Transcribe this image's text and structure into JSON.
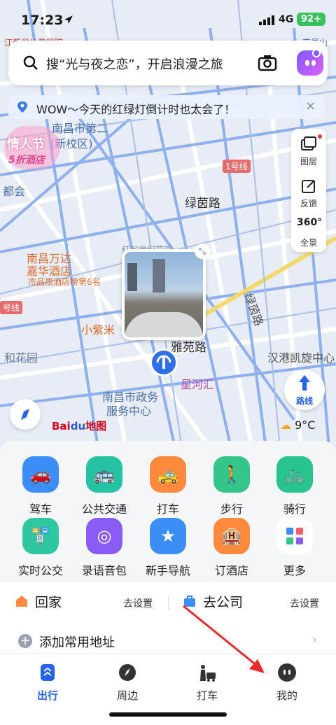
{
  "status": {
    "time": "17:23",
    "network": "4G",
    "battery": "92+"
  },
  "search": {
    "placeholder": "搜“光与夜之恋”，开启浪漫之旅"
  },
  "tip": {
    "text": "WOW～今天的红绿灯倒计时也太会了！",
    "close": "×"
  },
  "side_tools": [
    {
      "label": "图层",
      "icon": "layers-icon"
    },
    {
      "label": "反馈",
      "icon": "feedback-icon"
    },
    {
      "label": "全景",
      "icon": "panorama-360-icon",
      "glyph": "360°"
    }
  ],
  "map": {
    "labels": {
      "l1": "南昌市第二",
      "l2": "(新校区)",
      "l3": "都会",
      "l4": "绿茵路",
      "l5": "南昌万达",
      "l6": "嘉华酒店",
      "l7": "市品质酒店榜第6名",
      "l8": "号线",
      "l9": "小紫米",
      "l10": "和花园",
      "l11": "雅苑路",
      "l12": "星河汇",
      "l13": "南昌市政务",
      "l14": "服务中心",
      "l15": "汉港凯旋中心",
      "l16": "1号线",
      "l17": "红谷世纪花园",
      "l18": "江西省儿童医院",
      "l19": "南昌山",
      "l20": "绿茵路"
    },
    "promo": {
      "line1": "情人节",
      "line2": "5折酒店"
    },
    "route_label": "路线",
    "weather": "9°C",
    "logo": {
      "bai": "Bai",
      "du": "du",
      "map": "地图"
    }
  },
  "quick_actions": [
    {
      "label": "驾车",
      "icon": "car-icon",
      "color": "#3b8ef5",
      "glyph": "🚗"
    },
    {
      "label": "公共交通",
      "icon": "bus-icon",
      "color": "#26c2a4",
      "glyph": "🚌"
    },
    {
      "label": "打车",
      "icon": "taxi-icon",
      "color": "#ff8a3d",
      "glyph": "🚕"
    },
    {
      "label": "步行",
      "icon": "walk-icon",
      "color": "#34c58b",
      "glyph": "🚶"
    },
    {
      "label": "骑行",
      "icon": "bike-icon",
      "color": "#27c48e",
      "glyph": "🚲"
    },
    {
      "label": "实时公交",
      "icon": "realtime-bus-icon",
      "color": "#2fc7a0",
      "glyph": "🚏"
    },
    {
      "label": "录语音包",
      "icon": "voice-pack-icon",
      "color": "#8a5cf6",
      "glyph": "◎"
    },
    {
      "label": "新手导航",
      "icon": "beginner-nav-icon",
      "color": "#3b8ef5",
      "glyph": "★"
    },
    {
      "label": "订酒店",
      "icon": "hotel-icon",
      "color": "#ff8a3d",
      "glyph": "🏨"
    },
    {
      "label": "更多",
      "icon": "more-grid-icon",
      "color": "#ffffff",
      "glyph": ""
    }
  ],
  "places": {
    "home": "回家",
    "home_action": "去设置",
    "company": "去公司",
    "company_action": "去设置",
    "add": "添加常用地址"
  },
  "tabs": [
    {
      "label": "出行",
      "icon": "travel-icon",
      "active": true
    },
    {
      "label": "周边",
      "icon": "nearby-compass-icon",
      "active": false
    },
    {
      "label": "打车",
      "icon": "taxi-tab-icon",
      "active": false
    },
    {
      "label": "我的",
      "icon": "profile-icon",
      "active": false
    }
  ]
}
